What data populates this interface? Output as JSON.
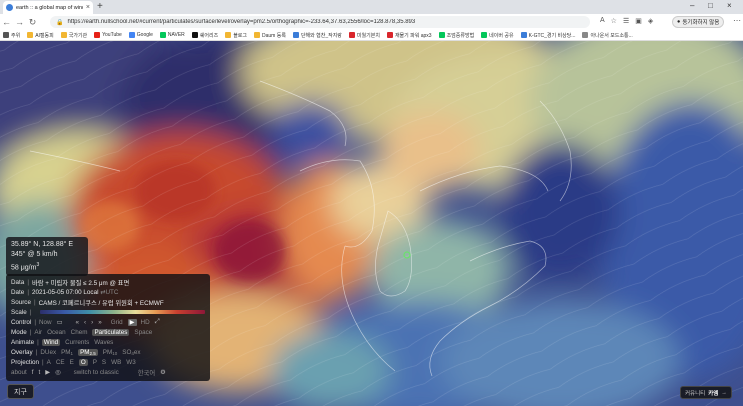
{
  "browser": {
    "tab_title": "earth :: a global map of wind, w...",
    "url": "https://earth.nullschool.net/#current/particulates/surface/level/overlay=pm2.5/orthographic=-233.64,37.63,2556/loc=128.878,35.893",
    "profile_label": "동기화하지 않음",
    "bookmarks": [
      {
        "label": "주위",
        "color": "#555555"
      },
      {
        "label": "AI캘동피",
        "color": "#f2b632"
      },
      {
        "label": "국가기관",
        "color": "#f2b632"
      },
      {
        "label": "YouTube",
        "color": "#e62117"
      },
      {
        "label": "Google",
        "color": "#4285f4"
      },
      {
        "label": "NAVER",
        "color": "#03c75a"
      },
      {
        "label": "쉐어리즈",
        "color": "#111111"
      },
      {
        "label": "블로그",
        "color": "#f2b632"
      },
      {
        "label": "Daum 등록",
        "color": "#f2b632"
      },
      {
        "label": "단해와 협찬_작지랑",
        "color": "#3b7dd8"
      },
      {
        "label": "미월기본치",
        "color": "#d9262c"
      },
      {
        "label": "재물기 파워 apx3",
        "color": "#d9262c"
      },
      {
        "label": "조엄중류방법",
        "color": "#03c75a"
      },
      {
        "label": "네이버 공유",
        "color": "#03c75a"
      },
      {
        "label": "K-GTC_경기 비상당...",
        "color": "#3b7dd8"
      },
      {
        "label": "아나운서 모드소통...",
        "color": "#888888"
      }
    ]
  },
  "readout": {
    "coords": "35.89° N, 128.88° E",
    "wind": "345° @ 5 km/h",
    "value": "58",
    "unit": "μg/m",
    "unit_sup": "3"
  },
  "panel": {
    "data_label": "Data",
    "data_value": "바람 + 미립자 물질 ≤ 2.5 μm @ 표면",
    "date_label": "Date",
    "date_value": "2021-05-05 07:00 Local",
    "date_utc": "⇄UTC",
    "source_label": "Source",
    "source_value": "CAMS / 코페르니쿠스 / 유럽 위원회 + ECMWF",
    "scale_label": "Scale",
    "control_label": "Control",
    "control_now": "Now",
    "control_grid": "Grid",
    "control_hd": "HD",
    "mode_label": "Mode",
    "mode_options": [
      "Air",
      "Ocean",
      "Chem",
      "Particulates",
      "Space"
    ],
    "mode_selected": "Particulates",
    "animate_label": "Animate",
    "animate_options": [
      "Wind",
      "Currents",
      "Waves"
    ],
    "animate_selected": "Wind",
    "overlay_label": "Overlay",
    "overlay_duex": "DUex",
    "overlay_pm1": "PM",
    "overlay_pm1_sub": "1",
    "overlay_pm25": "PM",
    "overlay_pm25_sub": "2.5",
    "overlay_pm10": "PM",
    "overlay_pm10_sub": "10",
    "overlay_so4": "SO",
    "overlay_so4_sub": "4",
    "overlay_so4_end": "ex",
    "projection_label": "Projection",
    "projection_options": [
      "A",
      "CE",
      "E",
      "O",
      "P",
      "S",
      "WB",
      "W3"
    ],
    "projection_selected": "O",
    "footer_about": "about",
    "footer_classic": "switch to classic",
    "footer_lang": "한국어"
  },
  "earth_button": "지구",
  "ad_button_prefix": "커유니티",
  "ad_button_main": "카엠",
  "ad_button_suffix": "→"
}
